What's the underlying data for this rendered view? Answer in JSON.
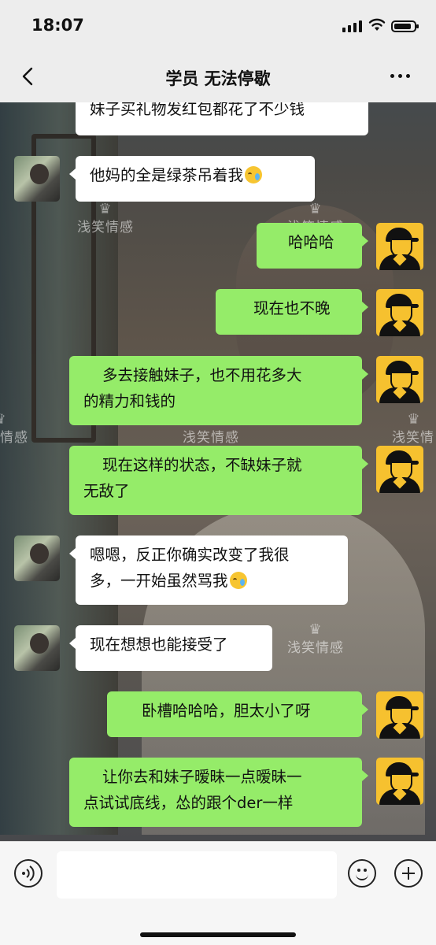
{
  "status_bar": {
    "time": "18:07"
  },
  "header": {
    "title": "学员 无法停歇"
  },
  "watermark": "浅笑情感",
  "messages": [
    {
      "side": "left",
      "text": "妹子买礼物发红包都花了不少钱",
      "emoji": false
    },
    {
      "side": "left",
      "text": "他妈的全是绿茶吊着我",
      "emoji": true
    },
    {
      "side": "right",
      "text": "哈哈哈"
    },
    {
      "side": "right",
      "text": "现在也不晚"
    },
    {
      "side": "right",
      "line1": "多去接触妹子，也不用花多大",
      "line2": "的精力和钱的"
    },
    {
      "side": "right",
      "line1": "现在这样的状态，不缺妹子就",
      "line2": "无敌了"
    },
    {
      "side": "left",
      "line1": "嗯嗯，反正你确实改变了我很",
      "line2": "多，一开始虽然骂我",
      "emoji": true
    },
    {
      "side": "left",
      "text": "现在想想也能接受了"
    },
    {
      "side": "right",
      "text": "卧槽哈哈哈，胆太小了呀"
    },
    {
      "side": "right",
      "line1": "让你去和妹子暧昧一点暧昧一",
      "line2": "点试试底线，怂的跟个der一样"
    }
  ],
  "input_bar": {
    "value": ""
  },
  "icons": {
    "back": "chevron-left-icon",
    "more": "more-dots-icon",
    "voice": "voice-icon",
    "emoji": "emoji-icon",
    "plus": "plus-icon"
  }
}
